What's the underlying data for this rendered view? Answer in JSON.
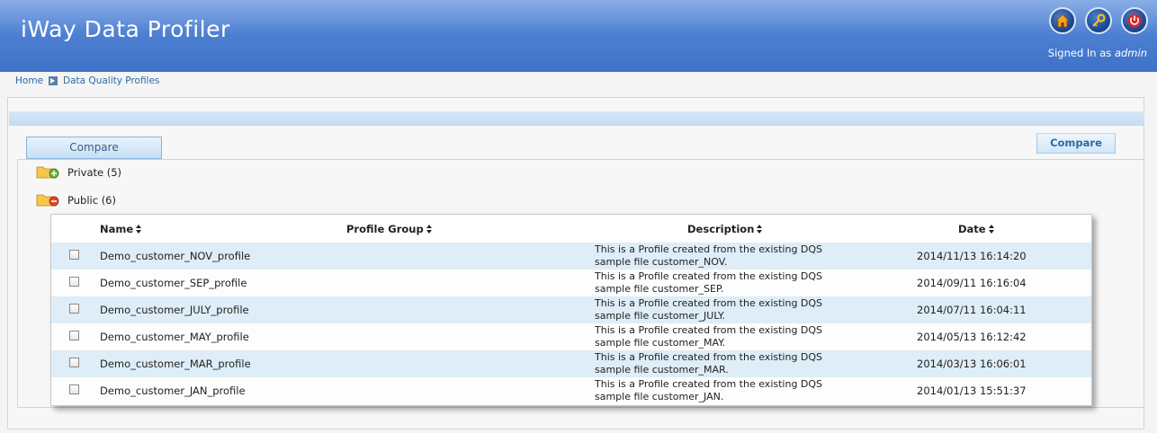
{
  "header": {
    "title": "iWay Data Profiler",
    "signed_in_prefix": "Signed In as",
    "user": "admin",
    "icons": [
      "home-icon",
      "key-icon",
      "power-icon"
    ]
  },
  "breadcrumb": {
    "home": "Home",
    "current": "Data Quality Profiles"
  },
  "tabs": {
    "compare_tab": "Compare"
  },
  "actions": {
    "compare_button": "Compare"
  },
  "folders": [
    {
      "label": "Private (5)",
      "state": "collapsed"
    },
    {
      "label": "Public (6)",
      "state": "expanded"
    }
  ],
  "table": {
    "columns": [
      "Name",
      "Profile Group",
      "Description",
      "Date"
    ],
    "rows": [
      {
        "name": "Demo_customer_NOV_profile",
        "group": "",
        "desc1": "This is a Profile created from the existing DQS",
        "desc2": "sample file customer_NOV.",
        "date": "2014/11/13 16:14:20"
      },
      {
        "name": "Demo_customer_SEP_profile",
        "group": "",
        "desc1": "This is a Profile created from the existing DQS",
        "desc2": "sample file customer_SEP.",
        "date": "2014/09/11 16:16:04"
      },
      {
        "name": "Demo_customer_JULY_profile",
        "group": "",
        "desc1": "This is a Profile created from the existing DQS",
        "desc2": "sample file customer_JULY.",
        "date": "2014/07/11 16:04:11"
      },
      {
        "name": "Demo_customer_MAY_profile",
        "group": "",
        "desc1": "This is a Profile created from the existing DQS",
        "desc2": "sample file customer_MAY.",
        "date": "2014/05/13 16:12:42"
      },
      {
        "name": "Demo_customer_MAR_profile",
        "group": "",
        "desc1": "This is a Profile created from the existing DQS",
        "desc2": "sample file customer_MAR.",
        "date": "2014/03/13 16:06:01"
      },
      {
        "name": "Demo_customer_JAN_profile",
        "group": "",
        "desc1": "This is a Profile created from the existing DQS",
        "desc2": "sample file customer_JAN.",
        "date": "2014/01/13 15:51:37"
      }
    ]
  },
  "colors": {
    "header_blue": "#4d80d2",
    "row_alt": "#deedf7",
    "link": "#2d6aa6"
  }
}
